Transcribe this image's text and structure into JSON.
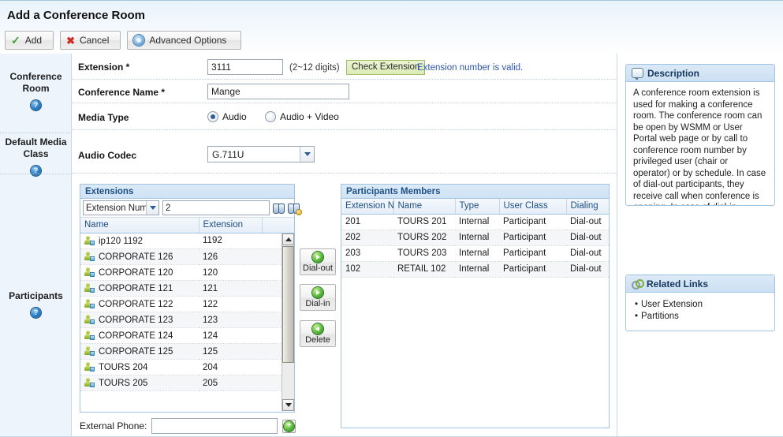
{
  "header": {
    "title": "Add a Conference Room",
    "buttons": [
      {
        "label": "Add",
        "icon": "check-icon"
      },
      {
        "label": "Cancel",
        "icon": "close-icon"
      },
      {
        "label": "Advanced Options",
        "icon": "gear-icon"
      }
    ]
  },
  "sidebar_left": {
    "sections": [
      {
        "label": "Conference Room",
        "help": "?"
      },
      {
        "label": "Default Media Class",
        "help": "?"
      },
      {
        "label": "Participants",
        "help": "?"
      }
    ]
  },
  "form": {
    "extension": {
      "label": "Extension *",
      "value": "3111",
      "placeholder": "",
      "hint": "(2~12 digits)",
      "check_button": "Check Extension",
      "validation_message": "Extension number is valid."
    },
    "conference_name": {
      "label": "Conference Name *",
      "value": "Mange",
      "placeholder": ""
    },
    "media_type": {
      "label": "Media Type",
      "options": [
        {
          "label": "Audio",
          "selected": true
        },
        {
          "label": "Audio + Video",
          "selected": false
        }
      ]
    },
    "audio_codec": {
      "label": "Audio Codec",
      "value": "G.711U"
    }
  },
  "extensions_panel": {
    "title": "Extensions",
    "search_field": "Extension Numb",
    "search_value": "2",
    "search_placeholder": "",
    "columns": [
      "Name",
      "Extension"
    ],
    "rows": [
      {
        "name": "ip120 1192",
        "extension": "1192"
      },
      {
        "name": "CORPORATE 126",
        "extension": "126"
      },
      {
        "name": "CORPORATE 120",
        "extension": "120"
      },
      {
        "name": "CORPORATE 121",
        "extension": "121"
      },
      {
        "name": "CORPORATE 122",
        "extension": "122"
      },
      {
        "name": "CORPORATE 123",
        "extension": "123"
      },
      {
        "name": "CORPORATE 124",
        "extension": "124"
      },
      {
        "name": "CORPORATE 125",
        "extension": "125"
      },
      {
        "name": "TOURS 204",
        "extension": "204"
      },
      {
        "name": "TOURS 205",
        "extension": "205"
      }
    ]
  },
  "transfer_buttons": [
    {
      "label": "Dial-out",
      "direction": "right"
    },
    {
      "label": "Dial-in",
      "direction": "right"
    },
    {
      "label": "Delete",
      "direction": "left"
    }
  ],
  "members_panel": {
    "title": "Participants Members",
    "columns": [
      "Extension N",
      "Name",
      "Type",
      "User Class",
      "Dialing"
    ],
    "rows": [
      {
        "extension": "201",
        "name": "TOURS 201",
        "type": "Internal",
        "user_class": "Participant",
        "dialing": "Dial-out"
      },
      {
        "extension": "202",
        "name": "TOURS 202",
        "type": "Internal",
        "user_class": "Participant",
        "dialing": "Dial-out"
      },
      {
        "extension": "203",
        "name": "TOURS 203",
        "type": "Internal",
        "user_class": "Participant",
        "dialing": "Dial-out"
      },
      {
        "extension": "102",
        "name": "RETAIL 102",
        "type": "Internal",
        "user_class": "Participant",
        "dialing": "Dial-out"
      }
    ]
  },
  "external_phone": {
    "label": "External Phone:",
    "value": "",
    "placeholder": "",
    "add_button": "+"
  },
  "description_card": {
    "title": "Description",
    "text": "A conference room extension is used for making a conference room. The conference room can be open by WSMM or User Portal web page or by call to conference room number by privileged user (chair or operator) or by schedule. In case of dial-out participants, they receive call when conference is opening. In case of dial-in participants, they have to make a call to conference extension to join to opened conference."
  },
  "related_links_card": {
    "title": "Related Links",
    "links": [
      "User Extension",
      "Partitions"
    ]
  },
  "colors": {
    "accent": "#1d4f86",
    "panel_border": "#a3c4e0",
    "valid_text": "#2f57b0",
    "check_button_bg": "#e3f0c8",
    "sidebar_bg": "#eef4fb"
  }
}
